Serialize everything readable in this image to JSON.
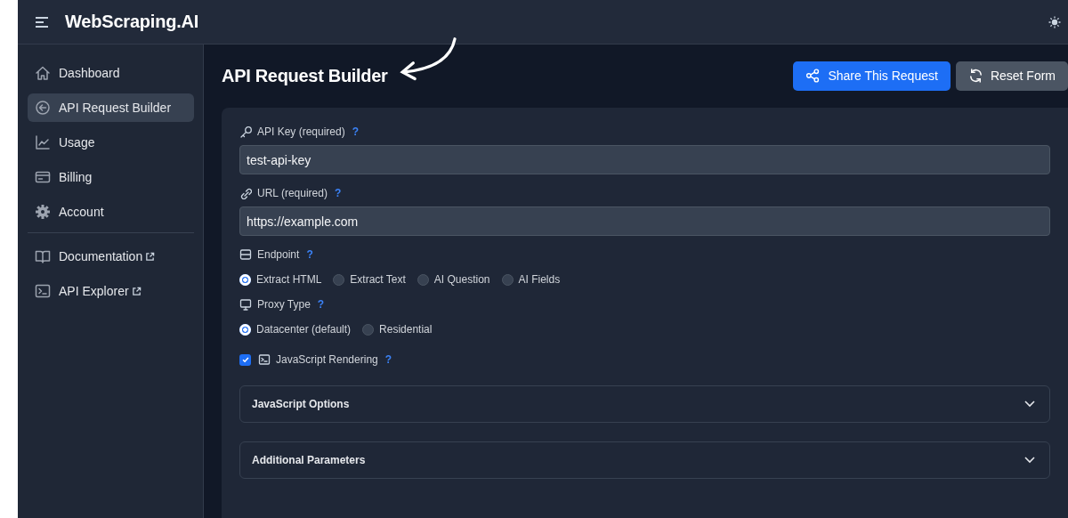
{
  "header": {
    "brand": "WebScraping.AI"
  },
  "sidebar": {
    "items": [
      {
        "label": "Dashboard",
        "selected": false,
        "external": false
      },
      {
        "label": "API Request Builder",
        "selected": true,
        "external": false
      },
      {
        "label": "Usage",
        "selected": false,
        "external": false
      },
      {
        "label": "Billing",
        "selected": false,
        "external": false
      },
      {
        "label": "Account",
        "selected": false,
        "external": false
      }
    ],
    "links": [
      {
        "label": "Documentation",
        "selected": false,
        "external": true
      },
      {
        "label": "API Explorer",
        "selected": false,
        "external": true
      }
    ]
  },
  "page": {
    "title": "API Request Builder",
    "buttons": [
      {
        "label": "Share This Request",
        "kind": "primary"
      },
      {
        "label": "Reset Form",
        "kind": "secondary"
      }
    ]
  },
  "form": {
    "fields": [
      {
        "label": "API Key (required)",
        "help": "?",
        "value": "test-api-key"
      },
      {
        "label": "URL (required)",
        "help": "?",
        "value": "https://example.com"
      }
    ],
    "groups": [
      {
        "label": "Endpoint",
        "help": "?",
        "options": [
          {
            "label": "Extract HTML",
            "selected": true
          },
          {
            "label": "Extract Text",
            "selected": false
          },
          {
            "label": "AI Question",
            "selected": false
          },
          {
            "label": "AI Fields",
            "selected": false
          }
        ]
      },
      {
        "label": "Proxy Type",
        "help": "?",
        "options": [
          {
            "label": "Datacenter (default)",
            "selected": true
          },
          {
            "label": "Residential",
            "selected": false
          }
        ]
      }
    ],
    "js_rendering": {
      "label": "JavaScript Rendering",
      "help": "?",
      "checked": true
    },
    "panels": [
      {
        "label": "JavaScript Options",
        "expanded": false
      },
      {
        "label": "Additional Parameters",
        "expanded": false
      }
    ]
  }
}
